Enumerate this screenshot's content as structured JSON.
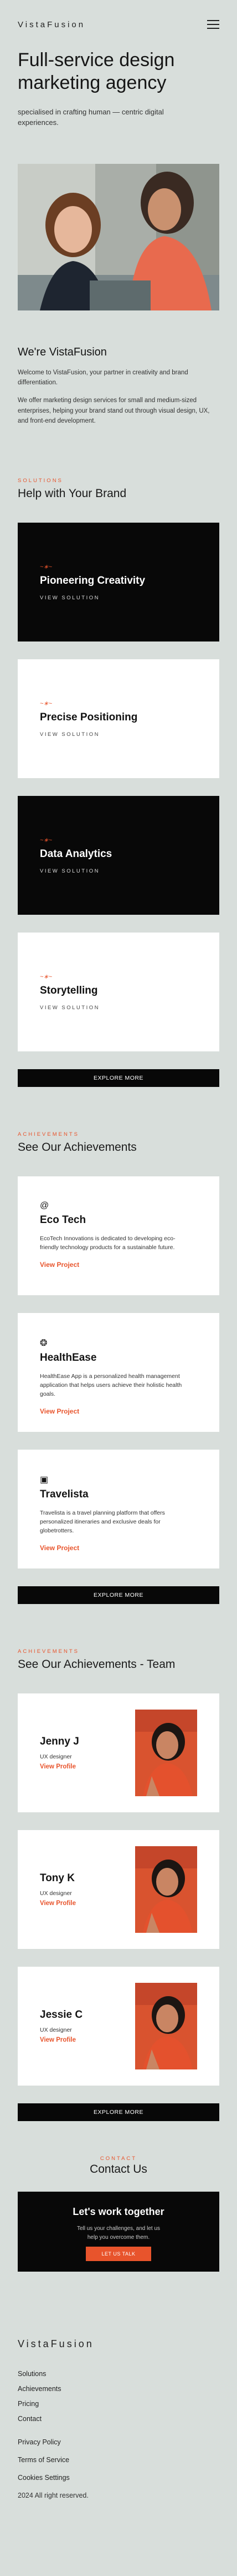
{
  "header": {
    "logo": "VistaFusion",
    "menu_icon": "hamburger-menu-icon"
  },
  "hero": {
    "title": "Full-service design marketing agency",
    "subtitle": "specialised in crafting human — centric digital experiences."
  },
  "about": {
    "title": "We're VistaFusion",
    "para1": "Welcome to VistaFusion, your partner in creativity and brand differentiation.",
    "para2": "We offer marketing design services for small and medium-sized enterprises, helping your brand stand out through visual design, UX, and front-end development."
  },
  "solutions": {
    "eyebrow": "SOLUTIONS",
    "title": "Help with Your Brand",
    "items": [
      {
        "title": "Pioneering Creativity",
        "link": "VIEW SOLUTION",
        "theme": "dark"
      },
      {
        "title": "Precise Positioning",
        "link": "VIEW SOLUTION",
        "theme": "light"
      },
      {
        "title": "Data Analytics",
        "link": "VIEW SOLUTION",
        "theme": "dark"
      },
      {
        "title": "Storytelling",
        "link": "VIEW SOLUTION",
        "theme": "light"
      }
    ],
    "more": "EXPLORE MORE"
  },
  "achievements": {
    "eyebrow": "ACHIEVEMENTS",
    "title": "See Our Achievements",
    "items": [
      {
        "icon": "leaf-icon",
        "glyph": "@",
        "title": "Eco Tech",
        "desc": "EcoTech Innovations is dedicated to developing eco-friendly technology products for a sustainable future.",
        "link": "View Project"
      },
      {
        "icon": "health-icon",
        "glyph": "❂",
        "title": "HealthEase",
        "desc": "HealthEase App is a personalized health management application that helps users achieve their holistic health goals.",
        "link": "View Project"
      },
      {
        "icon": "travel-icon",
        "glyph": "▣",
        "title": "Travelista",
        "desc": "Travelista is a travel planning platform that offers personalized itineraries and exclusive deals for globetrotters.",
        "link": "View Project"
      }
    ],
    "more": "EXPLORE MORE"
  },
  "team": {
    "eyebrow": "ACHIEVEMENTS",
    "title": "See Our Achievements - Team",
    "members": [
      {
        "name": "Jenny J",
        "role": "UX designer",
        "link": "View Profile"
      },
      {
        "name": "Tony K",
        "role": "UX designer",
        "link": "View Profile"
      },
      {
        "name": "Jessie C",
        "role": "UX designer",
        "link": "View Profile"
      }
    ],
    "more": "EXPLORE MORE"
  },
  "contact": {
    "eyebrow": "CONTACT",
    "title": "Contact Us",
    "box_title": "Let's work together",
    "box_text": "Tell us your challenges, and let us help you overcome them.",
    "button": "LET US TALK"
  },
  "footer": {
    "logo": "VistaFusion",
    "nav": [
      "Solutions",
      "Achievements",
      "Pricing",
      "Contact"
    ],
    "legal": [
      "Privacy Policy",
      "Terms of Service",
      "Cookies Settings"
    ],
    "copyright": "2024 All right reserved."
  },
  "colors": {
    "accent": "#e8542c",
    "background": "#d8dedb",
    "dark": "#080808"
  }
}
